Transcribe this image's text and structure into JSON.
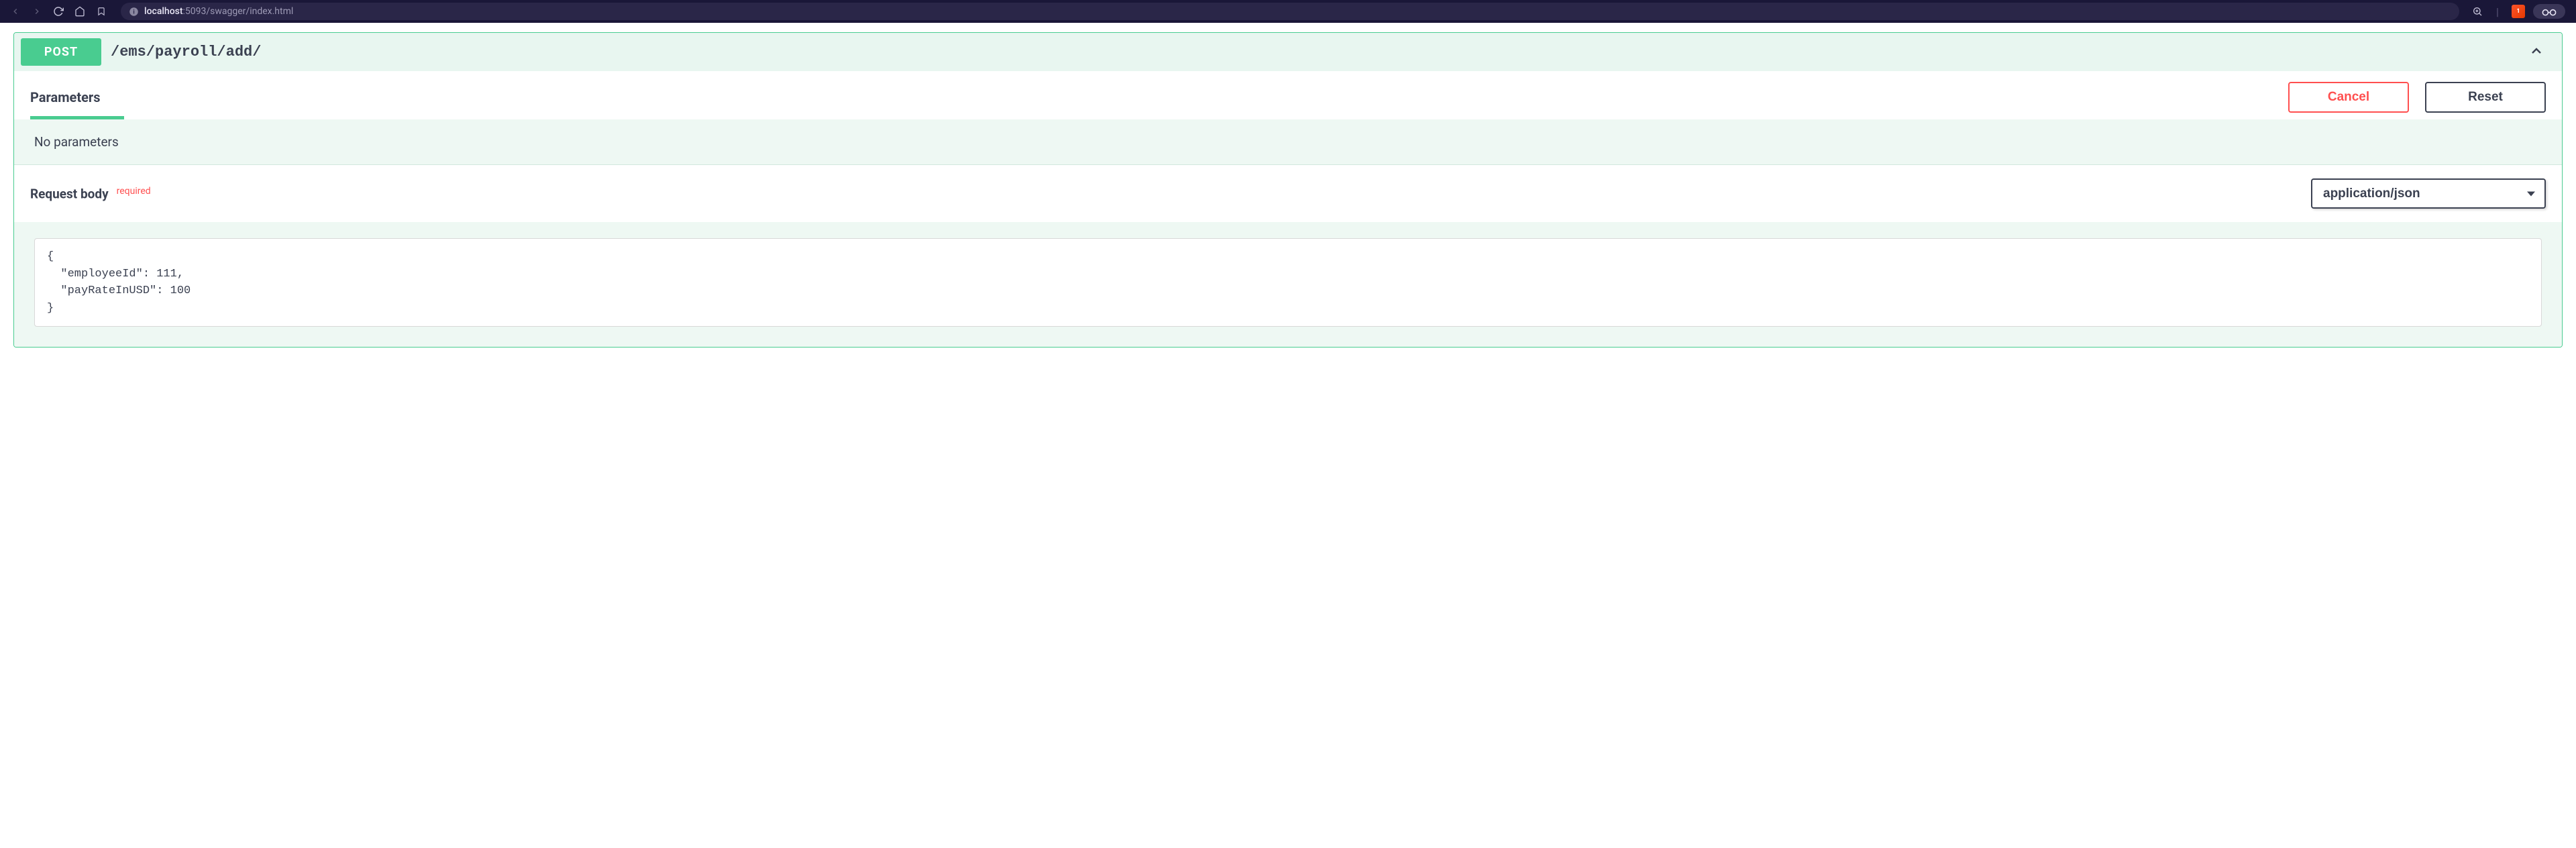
{
  "browser": {
    "url_host": "localhost",
    "url_path": ":5093/swagger/index.html",
    "brave_badge": "1"
  },
  "operation": {
    "method": "POST",
    "path": "/ems/payroll/add/"
  },
  "parameters": {
    "section_title": "Parameters",
    "cancel_label": "Cancel",
    "reset_label": "Reset",
    "no_parameters_text": "No parameters"
  },
  "request_body": {
    "title": "Request body",
    "required_label": "required",
    "content_type": "application/json",
    "body_text": "{\n  \"employeeId\": 111,\n  \"payRateInUSD\": 100\n}"
  }
}
